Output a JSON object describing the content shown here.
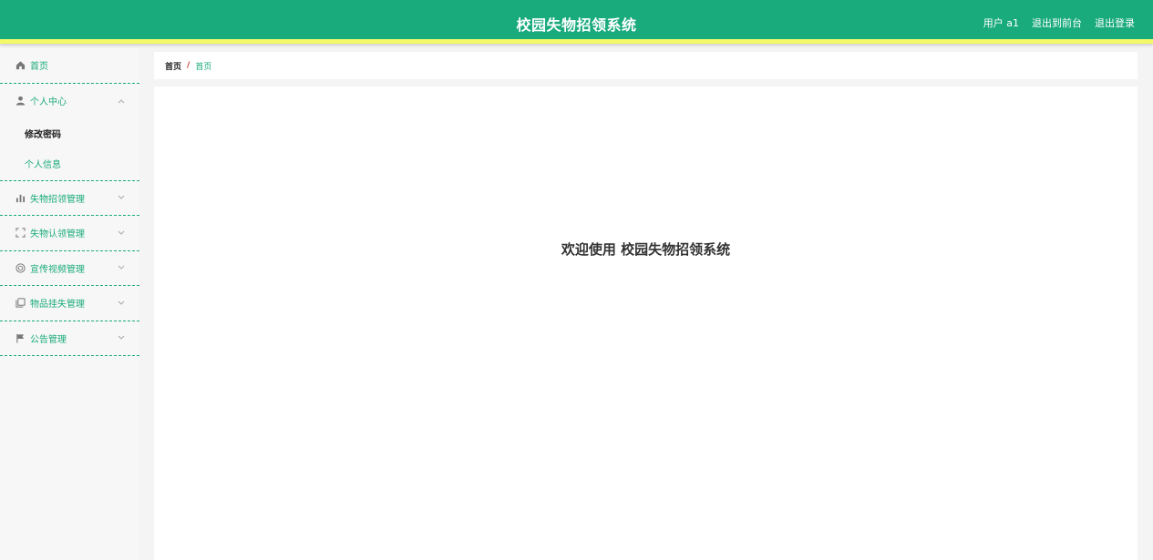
{
  "header": {
    "title": "校园失物招领系统",
    "user_label": "用户 a1",
    "front_label": "退出到前台",
    "logout_label": "退出登录"
  },
  "sidebar": {
    "home": {
      "label": "首页",
      "icon": "home-icon"
    },
    "personal": {
      "label": "个人中心",
      "icon": "user-icon",
      "children": [
        {
          "label": "修改密码"
        },
        {
          "label": "个人信息"
        }
      ]
    },
    "items": [
      {
        "label": "失物招领管理",
        "icon": "bar-chart-icon"
      },
      {
        "label": "失物认领管理",
        "icon": "scan-frame-icon"
      },
      {
        "label": "宣传视频管理",
        "icon": "circle-icon"
      },
      {
        "label": "物品挂失管理",
        "icon": "copy-icon"
      },
      {
        "label": "公告管理",
        "icon": "flag-icon"
      }
    ]
  },
  "breadcrumb": {
    "first": "首页",
    "separator": "/",
    "current": "首页"
  },
  "main": {
    "welcome": "欢迎使用 校园失物招领系统"
  },
  "colors": {
    "primary": "#1aab7c",
    "accent": "#f4f96a"
  }
}
